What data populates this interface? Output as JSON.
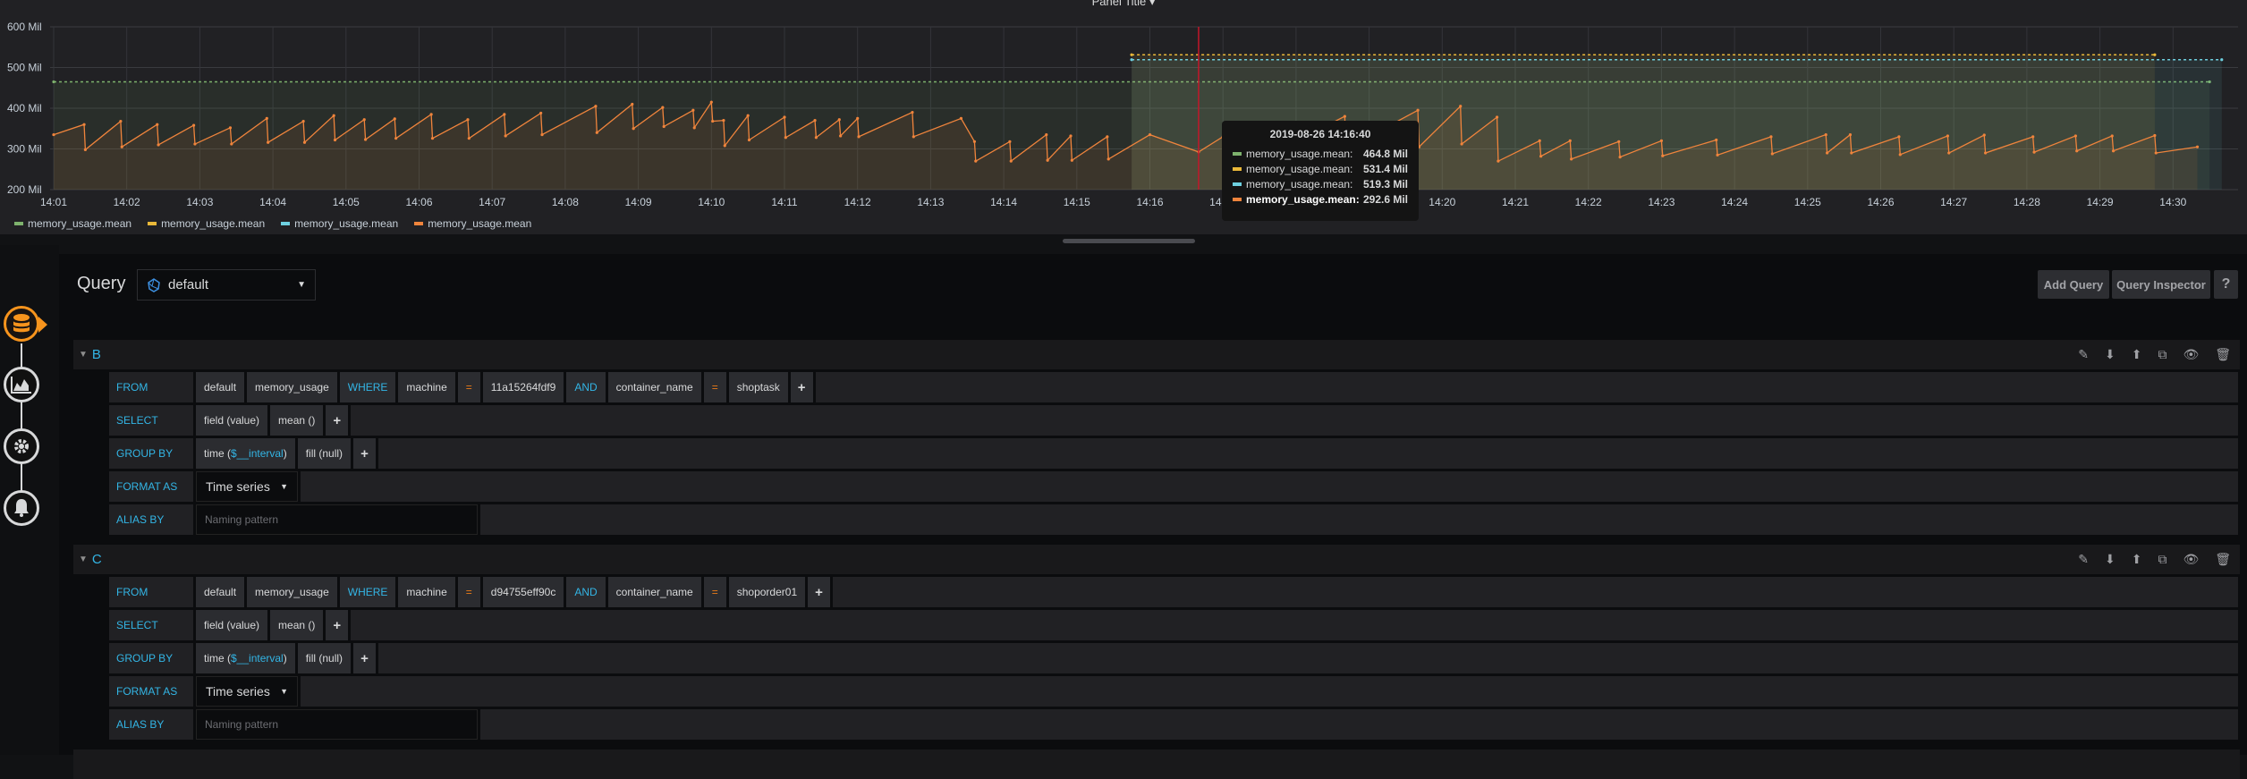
{
  "panel": {
    "title": "Panel Title ▾"
  },
  "chart_data": {
    "type": "line",
    "ylim": [
      200,
      600
    ],
    "yticks": [
      "200 Mil",
      "300 Mil",
      "400 Mil",
      "500 Mil",
      "600 Mil"
    ],
    "ytick_values": [
      200,
      300,
      400,
      500,
      600
    ],
    "xlim": [
      "14:01:00",
      "14:30:50"
    ],
    "xticks": [
      "14:01",
      "14:02",
      "14:03",
      "14:04",
      "14:05",
      "14:06",
      "14:07",
      "14:08",
      "14:09",
      "14:10",
      "14:11",
      "14:12",
      "14:13",
      "14:14",
      "14:15",
      "14:16",
      "14:17",
      "14:18",
      "14:19",
      "14:20",
      "14:21",
      "14:22",
      "14:23",
      "14:24",
      "14:25",
      "14:26",
      "14:27",
      "14:28",
      "14:29",
      "14:30"
    ],
    "grid": true,
    "legend_placement": "bottom-left",
    "y_unit": "Mil",
    "series": [
      {
        "name": "memory_usage.mean",
        "color": "#7eb26d",
        "points": [
          [
            "14:01:00",
            464.8
          ],
          [
            "14:30:30",
            464.8
          ]
        ]
      },
      {
        "name": "memory_usage.mean",
        "color": "#eab839",
        "points": [
          [
            "14:15:45",
            531.4
          ],
          [
            "14:29:45",
            531.4
          ]
        ]
      },
      {
        "name": "memory_usage.mean",
        "color": "#6ed0e0",
        "points": [
          [
            "14:15:45",
            519.3
          ],
          [
            "14:30:40",
            519.3
          ]
        ]
      },
      {
        "name": "memory_usage.mean",
        "color": "#ef843c",
        "points": [
          [
            "14:01:00",
            335
          ],
          [
            "14:01:25",
            360
          ],
          [
            "14:01:26",
            298
          ],
          [
            "14:01:55",
            368
          ],
          [
            "14:01:56",
            305
          ],
          [
            "14:02:25",
            360
          ],
          [
            "14:02:26",
            310
          ],
          [
            "14:02:55",
            358
          ],
          [
            "14:02:56",
            312
          ],
          [
            "14:03:25",
            352
          ],
          [
            "14:03:26",
            312
          ],
          [
            "14:03:55",
            375
          ],
          [
            "14:03:56",
            316
          ],
          [
            "14:04:25",
            368
          ],
          [
            "14:04:26",
            316
          ],
          [
            "14:04:50",
            382
          ],
          [
            "14:04:51",
            322
          ],
          [
            "14:05:15",
            372
          ],
          [
            "14:05:16",
            323
          ],
          [
            "14:05:40",
            374
          ],
          [
            "14:05:41",
            326
          ],
          [
            "14:06:10",
            385
          ],
          [
            "14:06:11",
            326
          ],
          [
            "14:06:40",
            372
          ],
          [
            "14:06:41",
            326
          ],
          [
            "14:07:10",
            385
          ],
          [
            "14:07:11",
            332
          ],
          [
            "14:07:40",
            388
          ],
          [
            "14:07:41",
            335
          ],
          [
            "14:08:25",
            405
          ],
          [
            "14:08:26",
            340
          ],
          [
            "14:08:55",
            410
          ],
          [
            "14:08:56",
            350
          ],
          [
            "14:09:20",
            402
          ],
          [
            "14:09:21",
            355
          ],
          [
            "14:09:45",
            395
          ],
          [
            "14:09:46",
            352
          ],
          [
            "14:10:00",
            415
          ],
          [
            "14:10:01",
            368
          ],
          [
            "14:10:10",
            370
          ],
          [
            "14:10:11",
            308
          ],
          [
            "14:10:30",
            382
          ],
          [
            "14:10:31",
            322
          ],
          [
            "14:11:00",
            378
          ],
          [
            "14:11:01",
            328
          ],
          [
            "14:11:25",
            370
          ],
          [
            "14:11:26",
            328
          ],
          [
            "14:11:45",
            372
          ],
          [
            "14:11:46",
            332
          ],
          [
            "14:12:00",
            375
          ],
          [
            "14:12:01",
            330
          ],
          [
            "14:12:45",
            390
          ],
          [
            "14:12:46",
            330
          ],
          [
            "14:13:25",
            375
          ],
          [
            "14:13:36",
            318
          ],
          [
            "14:13:37",
            270
          ],
          [
            "14:14:05",
            318
          ],
          [
            "14:14:06",
            270
          ],
          [
            "14:14:35",
            335
          ],
          [
            "14:14:36",
            272
          ],
          [
            "14:14:55",
            332
          ],
          [
            "14:14:56",
            272
          ],
          [
            "14:15:25",
            330
          ],
          [
            "14:15:26",
            275
          ],
          [
            "14:16:00",
            335
          ],
          [
            "14:16:40",
            292.6
          ],
          [
            "14:17:00",
            330
          ],
          [
            "14:17:01",
            280
          ],
          [
            "14:17:40",
            350
          ],
          [
            "14:17:41",
            290
          ],
          [
            "14:18:40",
            380
          ],
          [
            "14:18:41",
            300
          ],
          [
            "14:19:40",
            395
          ],
          [
            "14:19:41",
            305
          ],
          [
            "14:20:15",
            405
          ],
          [
            "14:20:16",
            312
          ],
          [
            "14:20:45",
            378
          ],
          [
            "14:20:46",
            270
          ],
          [
            "14:21:20",
            320
          ],
          [
            "14:21:21",
            282
          ],
          [
            "14:21:45",
            320
          ],
          [
            "14:21:46",
            275
          ],
          [
            "14:22:25",
            318
          ],
          [
            "14:22:26",
            280
          ],
          [
            "14:23:00",
            320
          ],
          [
            "14:23:01",
            283
          ],
          [
            "14:23:45",
            322
          ],
          [
            "14:23:46",
            285
          ],
          [
            "14:24:30",
            330
          ],
          [
            "14:24:31",
            288
          ],
          [
            "14:25:15",
            335
          ],
          [
            "14:25:16",
            290
          ],
          [
            "14:25:35",
            335
          ],
          [
            "14:25:36",
            290
          ],
          [
            "14:26:15",
            330
          ],
          [
            "14:26:16",
            286
          ],
          [
            "14:26:55",
            332
          ],
          [
            "14:26:56",
            290
          ],
          [
            "14:27:25",
            334
          ],
          [
            "14:27:26",
            290
          ],
          [
            "14:28:05",
            330
          ],
          [
            "14:28:06",
            292
          ],
          [
            "14:28:40",
            332
          ],
          [
            "14:28:41",
            295
          ],
          [
            "14:29:10",
            332
          ],
          [
            "14:29:11",
            295
          ],
          [
            "14:29:45",
            333
          ],
          [
            "14:29:46",
            290
          ],
          [
            "14:30:20",
            305
          ]
        ]
      }
    ],
    "cursor_time": "14:16:40"
  },
  "legend": [
    "memory_usage.mean",
    "memory_usage.mean",
    "memory_usage.mean",
    "memory_usage.mean"
  ],
  "tooltip": {
    "time": "2019-08-26 14:16:40",
    "rows": [
      {
        "name": "memory_usage.mean:",
        "value": "464.8 Mil"
      },
      {
        "name": "memory_usage.mean:",
        "value": "531.4 Mil"
      },
      {
        "name": "memory_usage.mean:",
        "value": "519.3 Mil"
      },
      {
        "name": "memory_usage.mean:",
        "value": "292.6 Mil"
      }
    ]
  },
  "sidebar": {
    "icons": [
      "database-icon",
      "chart-area-icon",
      "gear-icon",
      "bell-icon"
    ]
  },
  "query_editor": {
    "title": "Query",
    "datasource": "default",
    "buttons": {
      "add_query": "Add Query",
      "query_inspector": "Query Inspector",
      "help": "?"
    },
    "actions": [
      "pencil-icon",
      "arrow-down-icon",
      "arrow-up-icon",
      "copy-icon",
      "eye-icon",
      "trash-icon"
    ],
    "queries": [
      {
        "ref": "B",
        "from": [
          {
            "text": "FROM",
            "type": "label"
          },
          {
            "text": "default",
            "type": "val"
          },
          {
            "text": "memory_usage",
            "type": "val"
          },
          {
            "text": "WHERE",
            "type": "kw"
          },
          {
            "text": "machine",
            "type": "val"
          },
          {
            "text": "=",
            "type": "op"
          },
          {
            "text": "11a15264fdf9",
            "type": "val"
          },
          {
            "text": "AND",
            "type": "kw"
          },
          {
            "text": "container_name",
            "type": "val"
          },
          {
            "text": "=",
            "type": "op"
          },
          {
            "text": "shoptask",
            "type": "val"
          },
          {
            "text": "+",
            "type": "plus"
          }
        ],
        "select": {
          "label": "SELECT",
          "parts": [
            "field (value)",
            "mean ()"
          ]
        },
        "group_by": {
          "label": "GROUP BY",
          "time_prefix": "time (",
          "time_var": "$__interval",
          "time_suffix": ")",
          "fill": "fill (null)"
        },
        "format_as": {
          "label": "FORMAT AS",
          "value": "Time series"
        },
        "alias_by": {
          "label": "ALIAS BY",
          "placeholder": "Naming pattern"
        }
      },
      {
        "ref": "C",
        "from": [
          {
            "text": "FROM",
            "type": "label"
          },
          {
            "text": "default",
            "type": "val"
          },
          {
            "text": "memory_usage",
            "type": "val"
          },
          {
            "text": "WHERE",
            "type": "kw"
          },
          {
            "text": "machine",
            "type": "val"
          },
          {
            "text": "=",
            "type": "op"
          },
          {
            "text": "d94755eff90c",
            "type": "val"
          },
          {
            "text": "AND",
            "type": "kw"
          },
          {
            "text": "container_name",
            "type": "val"
          },
          {
            "text": "=",
            "type": "op"
          },
          {
            "text": "shoporder01",
            "type": "val"
          },
          {
            "text": "+",
            "type": "plus"
          }
        ],
        "select": {
          "label": "SELECT",
          "parts": [
            "field (value)",
            "mean ()"
          ]
        },
        "group_by": {
          "label": "GROUP BY",
          "time_prefix": "time (",
          "time_var": "$__interval",
          "time_suffix": ")",
          "fill": "fill (null)"
        },
        "format_as": {
          "label": "FORMAT AS",
          "value": "Time series"
        },
        "alias_by": {
          "label": "ALIAS BY",
          "placeholder": "Naming pattern"
        }
      }
    ]
  }
}
